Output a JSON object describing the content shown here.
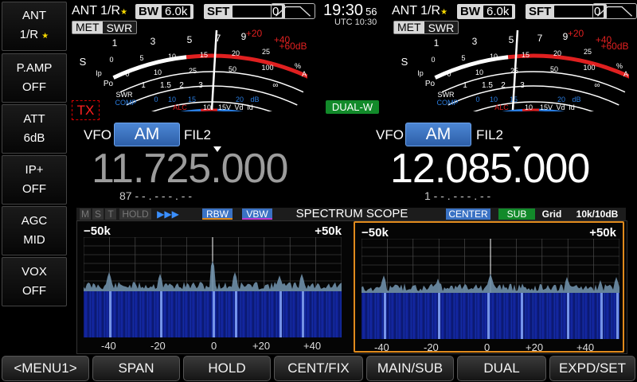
{
  "side_menu": [
    {
      "label": "ANT",
      "value": "1/R",
      "star": "★"
    },
    {
      "label": "P.AMP",
      "value": "OFF"
    },
    {
      "label": "ATT",
      "value": "6dB"
    },
    {
      "label": "IP+",
      "value": "OFF"
    },
    {
      "label": "AGC",
      "value": "MID"
    },
    {
      "label": "VOX",
      "value": "OFF"
    }
  ],
  "bottom_menu": [
    "<MENU1>",
    "SPAN",
    "HOLD",
    "CENT/FIX",
    "MAIN/SUB",
    "DUAL",
    "EXPD/SET"
  ],
  "clock": {
    "time": "19:30",
    "seconds": "56",
    "utc": "UTC 10:30"
  },
  "main": {
    "ant": "ANT 1/R",
    "star": "★",
    "bw_label": "BW",
    "bw": "6.0k",
    "sft_label": "SFT",
    "sft": "0",
    "met": "MET",
    "swr": "SWR",
    "tx": "TX",
    "vfo": "VFO",
    "mode": "AM",
    "fil": "FIL2",
    "freq": "11.725.000",
    "sub": "87  - - . - - - . - -"
  },
  "sub": {
    "ant": "ANT 1/R",
    "star": "★",
    "bw_label": "BW",
    "bw": "6.0k",
    "sft_label": "SFT",
    "sft": "0",
    "met": "MET",
    "swr": "SWR",
    "badge": "DUAL-W",
    "vfo": "VFO",
    "mode": "AM",
    "fil": "FIL2",
    "freq": "12.085.000",
    "sub": "1  - - . - - - . - -"
  },
  "meter_scale": {
    "s_label": "S",
    "po_label": "Po",
    "swr_label": "SWR",
    "comp_label": "COMP",
    "alc_label": "ALC",
    "s_ticks": [
      "1",
      "3",
      "5",
      "7",
      "9"
    ],
    "plus_ticks": [
      "+20",
      "+40",
      "+60dB"
    ],
    "ip_ticks": [
      "0",
      "5",
      "10",
      "15",
      "20",
      "25"
    ],
    "po_ticks": [
      "0",
      "10",
      "25",
      "50",
      "100",
      "%"
    ],
    "swr_ticks": [
      "1",
      "1.5",
      "2",
      "3",
      "∞"
    ],
    "comp_ticks": [
      "0",
      "10",
      "15",
      "20",
      "dB"
    ],
    "vd_ticks": [
      "10",
      "15V",
      "Vd"
    ],
    "amp_label": "A",
    "ip_label": "Ip",
    "id_label": "Id"
  },
  "scope": {
    "flags": [
      "M",
      "S",
      "T",
      "HOLD"
    ],
    "arrows": "▶▶▶",
    "rbw": "RBW",
    "vbw": "VBW",
    "title": "SPECTRUM SCOPE",
    "center": "CENTER",
    "sub": "SUB",
    "grid": "Grid",
    "grid_value": "10k/10dB",
    "left": {
      "minus": "−50k",
      "plus": "+50k",
      "axis": [
        "-40",
        "-20",
        "0",
        "+20",
        "+40"
      ]
    },
    "right": {
      "minus": "−50k",
      "plus": "+50k",
      "axis": [
        "-40",
        "-20",
        "0",
        "+20",
        "+40"
      ]
    }
  },
  "colors": {
    "accent": "#3a72c4",
    "tx": "#ff2020",
    "dualw": "#128a2a",
    "scope_highlight": "#e08a1c",
    "waterfall": "#1428a8"
  }
}
